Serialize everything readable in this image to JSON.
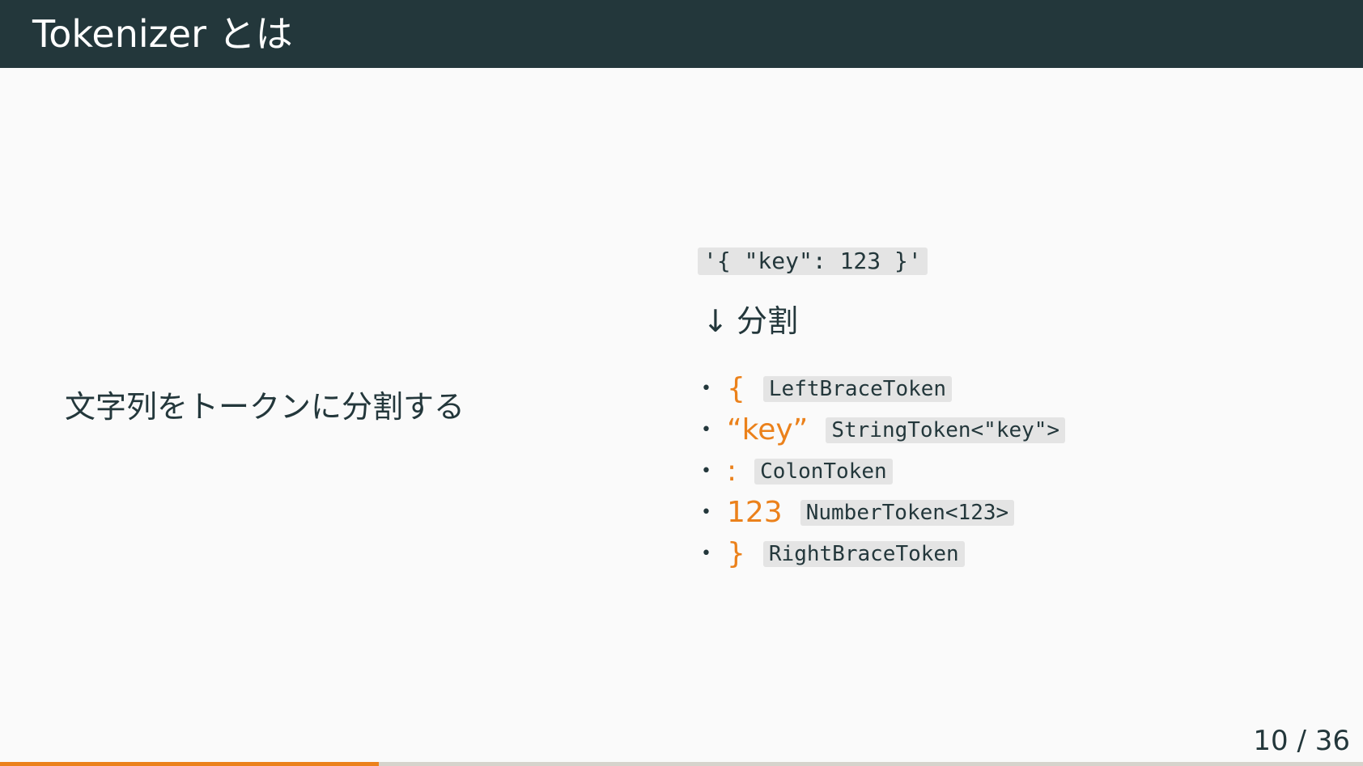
{
  "slide": {
    "title": "Tokenizer とは",
    "left_text": "文字列をトークンに分割する",
    "source_code": "'{ \"key\": 123 }'",
    "split_arrow": "↓",
    "split_label": "分割",
    "bullet_glyph": "•",
    "tokens": [
      {
        "symbol": "{",
        "name": "LeftBraceToken"
      },
      {
        "symbol": "“key”",
        "name": "StringToken<\"key\">"
      },
      {
        "symbol": ":",
        "name": "ColonToken"
      },
      {
        "symbol": "123",
        "name": "NumberToken<123>"
      },
      {
        "symbol": "}",
        "name": "RightBraceToken"
      }
    ]
  },
  "footer": {
    "page_label": "10 / 36",
    "progress_fraction": 0.2778
  },
  "colors": {
    "title_bar": "#23373b",
    "accent": "#eb811b",
    "background": "#fafafa",
    "code_background": "#e4e4e4",
    "progress_track": "#d6d3cc"
  }
}
